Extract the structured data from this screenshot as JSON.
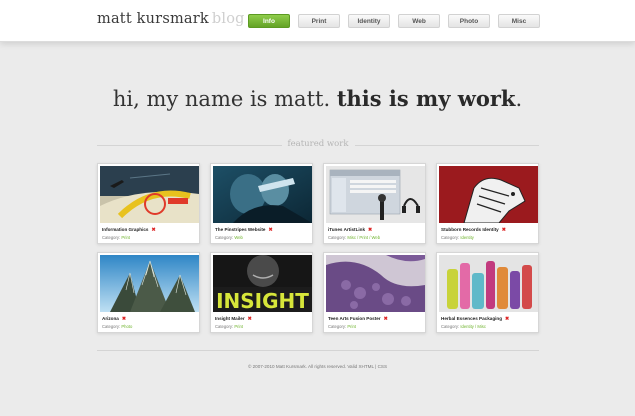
{
  "header": {
    "logo_main": "matt kursmark",
    "logo_suffix": "blog"
  },
  "nav": {
    "tabs": [
      {
        "label": "Info",
        "active": true
      },
      {
        "label": "Print",
        "active": false
      },
      {
        "label": "Identity",
        "active": false
      },
      {
        "label": "Web",
        "active": false
      },
      {
        "label": "Photo",
        "active": false
      },
      {
        "label": "Misc",
        "active": false
      }
    ]
  },
  "hero": {
    "intro": "hi, my name is matt.",
    "emphasis": "this is my work",
    "end": "."
  },
  "featured": {
    "title": "featured work",
    "category_label": "Category:",
    "items": [
      {
        "title": "Information Graphics",
        "category": "Print",
        "thumb_icon": "infographic-map-thumbnail"
      },
      {
        "title": "The Pinstripes Website",
        "category": "Web",
        "thumb_icon": "band-photo-thumbnail"
      },
      {
        "title": "iTunes ArtistLink",
        "category": "Misc / Print / Web",
        "thumb_icon": "itunes-screen-thumbnail"
      },
      {
        "title": "Stubborn Records Identity",
        "category": "Identity",
        "thumb_icon": "mule-logo-thumbnail"
      },
      {
        "title": "Arizona",
        "category": "Photo",
        "thumb_icon": "cactus-photo-thumbnail"
      },
      {
        "title": "Insight Mailer",
        "category": "Print",
        "thumb_icon": "insight-poster-thumbnail"
      },
      {
        "title": "Teen Arts Fusion Poster",
        "category": "Print",
        "thumb_icon": "purple-pattern-thumbnail"
      },
      {
        "title": "Herbal Essences Packaging",
        "category": "Identity / Misc",
        "thumb_icon": "bottles-thumbnail"
      }
    ]
  },
  "footer": {
    "text": "© 2007-2010 Matt Kursmark. All rights reserved. Valid XHTML | CSS"
  },
  "colors": {
    "accent": "#6fb32d",
    "remove": "#dd2222",
    "background": "#ebebeb"
  }
}
